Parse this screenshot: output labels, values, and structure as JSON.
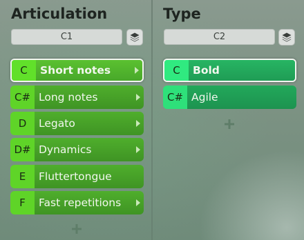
{
  "articulation": {
    "title": "Articulation",
    "key": "C1",
    "items": [
      {
        "note": "C",
        "label": "Short notes",
        "has_submenu": true,
        "selected": true
      },
      {
        "note": "C#",
        "label": "Long notes",
        "has_submenu": true,
        "selected": false
      },
      {
        "note": "D",
        "label": "Legato",
        "has_submenu": true,
        "selected": false
      },
      {
        "note": "D#",
        "label": "Dynamics",
        "has_submenu": true,
        "selected": false
      },
      {
        "note": "E",
        "label": "Fluttertongue",
        "has_submenu": false,
        "selected": false
      },
      {
        "note": "F",
        "label": "Fast repetitions",
        "has_submenu": true,
        "selected": false
      }
    ],
    "add_icon": "plus-icon"
  },
  "type": {
    "title": "Type",
    "key": "C2",
    "items": [
      {
        "note": "C",
        "label": "Bold",
        "selected": true
      },
      {
        "note": "C#",
        "label": "Agile",
        "selected": false
      }
    ],
    "add_icon": "plus-icon"
  },
  "colors": {
    "articulation_accent": "#5fd428",
    "type_accent": "#2ee07a",
    "selected_border": "#f3f6f2"
  },
  "icons": {
    "layers": "layers-icon",
    "submenu": "chevron-right-icon",
    "add": "plus-icon"
  }
}
